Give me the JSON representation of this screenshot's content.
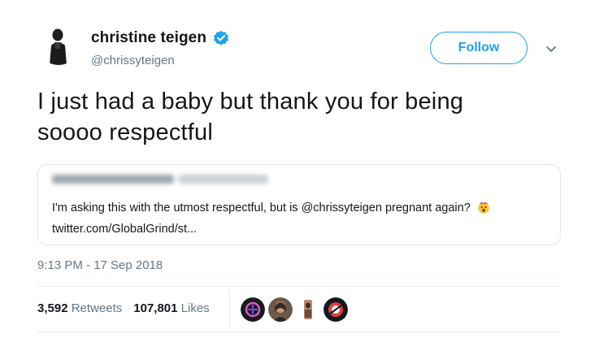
{
  "author": {
    "display_name": "christine teigen",
    "handle": "@chrissyteigen",
    "verified_icon": "verified-badge-icon"
  },
  "follow_label": "Follow",
  "tweet": {
    "text_line1": "I just had a baby but thank you for being",
    "text_line2": "soooo respectful"
  },
  "quote": {
    "text": "I'm asking this with the utmost respectful, but is @chrissyteigen pregnant again?",
    "link": "twitter.com/GlobalGrind/st..."
  },
  "timestamp": "9:13 PM - 17 Sep 2018",
  "stats": {
    "retweets_count": "3,592",
    "retweets_label": "Retweets",
    "likes_count": "107,801",
    "likes_label": "Likes"
  },
  "colors": {
    "accent": "#1da1f2",
    "muted": "#657786"
  }
}
